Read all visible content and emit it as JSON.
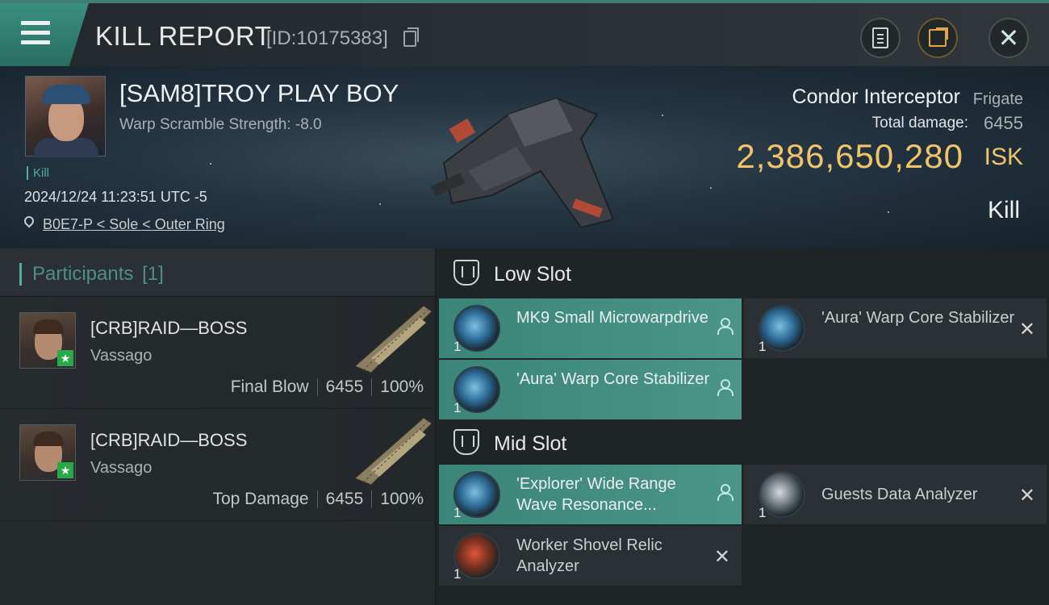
{
  "header": {
    "title": "KILL REPORT",
    "id_text": "[ID:10175383]"
  },
  "victim": {
    "name": "[SAM8]TROY PLAY BOY",
    "warp_scramble": "Warp Scramble Strength: -8.0",
    "tag": "Kill",
    "datetime": "2024/12/24 11:23:51 UTC -5",
    "location": "B0E7-P < Sole < Outer Ring",
    "ship_name": "Condor Interceptor",
    "ship_class": "Frigate",
    "total_damage_label": "Total damage:",
    "total_damage": "6455",
    "isk_value": "2,386,650,280",
    "isk_unit": "ISK",
    "result": "Kill"
  },
  "participants": {
    "label": "Participants",
    "count": "[1]",
    "rows": [
      {
        "name": "[CRB]RAID—BOSS",
        "ship": "Vassago",
        "role": "Final Blow",
        "damage": "6455",
        "percent": "100%"
      },
      {
        "name": "[CRB]RAID—BOSS",
        "ship": "Vassago",
        "role": "Top Damage",
        "damage": "6455",
        "percent": "100%"
      }
    ]
  },
  "slots": {
    "low_label": "Low Slot",
    "mid_label": "Mid Slot",
    "low": [
      {
        "name": "MK9 Small Microwarpdrive",
        "qty": "1",
        "state": "active",
        "icon": "microwarpdrive-icon"
      },
      {
        "name": "'Aura' Warp Core Stabilizer",
        "qty": "1",
        "state": "inactive",
        "icon": "stabilizer-icon"
      },
      {
        "name": "'Aura' Warp Core Stabilizer",
        "qty": "1",
        "state": "active",
        "icon": "stabilizer-icon"
      }
    ],
    "mid": [
      {
        "name": "'Explorer' Wide Range Wave Resonance...",
        "qty": "1",
        "state": "active",
        "icon": "scanner-icon"
      },
      {
        "name": "Guests Data Analyzer",
        "qty": "1",
        "state": "inactive",
        "icon": "data-analyzer-icon"
      },
      {
        "name": "Worker Shovel Relic Analyzer",
        "qty": "1",
        "state": "inactive",
        "icon": "relic-analyzer-icon"
      }
    ]
  },
  "colors": {
    "accent": "#4fb09c",
    "isk": "#f0c56a",
    "active_slot": "#3a8578"
  }
}
